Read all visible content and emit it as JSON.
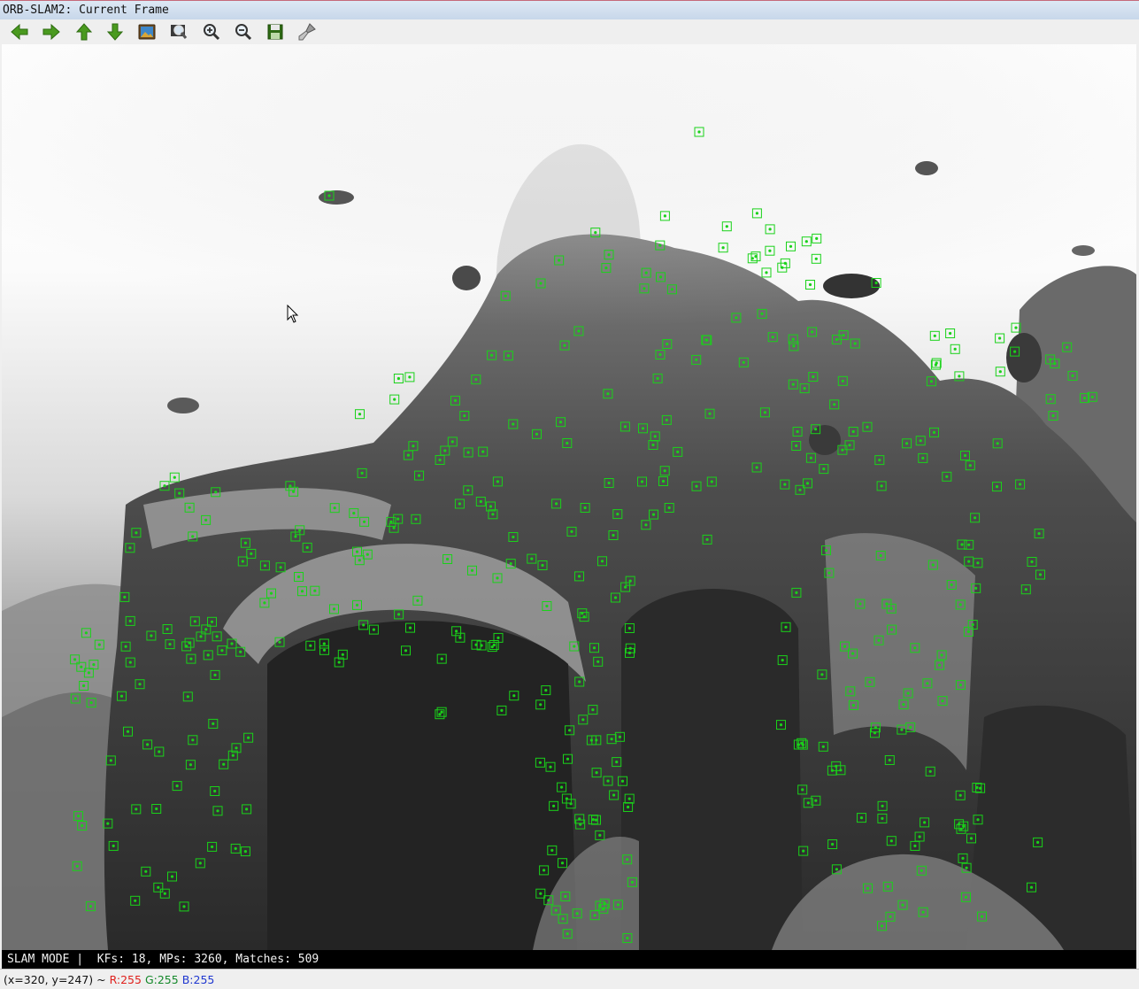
{
  "window": {
    "title": "ORB-SLAM2: Current Frame"
  },
  "toolbar": {
    "buttons": [
      {
        "icon": "arrow-left-icon",
        "label": "Pan left"
      },
      {
        "icon": "arrow-right-icon",
        "label": "Pan right"
      },
      {
        "icon": "arrow-up-icon",
        "label": "Pan up"
      },
      {
        "icon": "arrow-down-icon",
        "label": "Pan down"
      },
      {
        "icon": "image-icon",
        "label": "Zoom to original"
      },
      {
        "icon": "zoom-fit-icon",
        "label": "Zoom to fit"
      },
      {
        "icon": "zoom-in-icon",
        "label": "Zoom in"
      },
      {
        "icon": "zoom-out-icon",
        "label": "Zoom out"
      },
      {
        "icon": "save-icon",
        "label": "Save"
      },
      {
        "icon": "properties-brush-icon",
        "label": "Properties"
      }
    ]
  },
  "overlay": {
    "mode": "SLAM MODE",
    "separator": "|",
    "stats": "KFs: 18, MPs: 3260, Matches: 509"
  },
  "status": {
    "coords": "(x=320, y=247) ~",
    "r": "R:255",
    "g": "G:255",
    "b": "B:255"
  },
  "keypoint_color": "#19d219",
  "colors": {
    "title_bar": "#c7d7ea",
    "toolbar_arrow_green": "#3c8a1e",
    "overlay_bg": "#000000",
    "overlay_text": "#f2f2f2"
  }
}
